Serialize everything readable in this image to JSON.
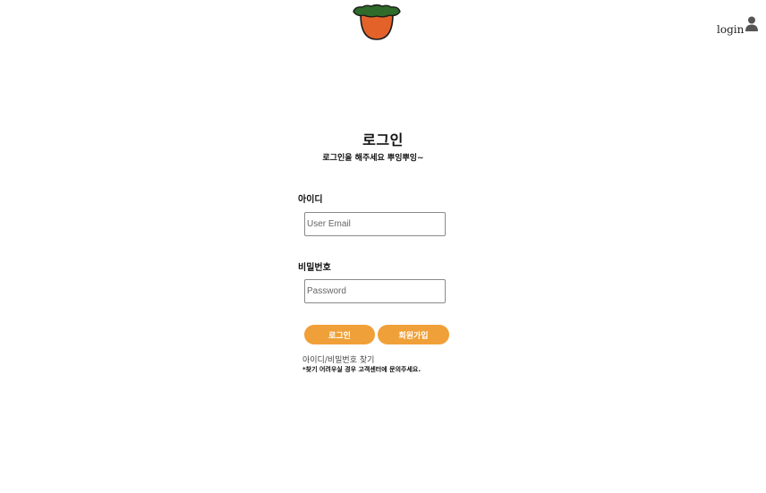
{
  "header": {
    "logo_icon": "carrot-logo-icon",
    "login_label": "login",
    "user_icon": "user-icon"
  },
  "colors": {
    "accent": "#f0a038",
    "logo_body": "#e2622a",
    "logo_leaves": "#2f6b2a"
  },
  "main": {
    "title": "로그인",
    "subtitle": "로그인을 해주세요 뿌잉뿌잉~",
    "id_label": "아이디",
    "email_placeholder": "User Email",
    "password_label": "비밀번호",
    "password_placeholder": "Password",
    "login_button": "로그인",
    "signup_button": "회원가입",
    "find_link": "아이디/비밀번호 찾기",
    "notice": "*찾기 어려우실 경우 고객센터에 문의주세요."
  }
}
